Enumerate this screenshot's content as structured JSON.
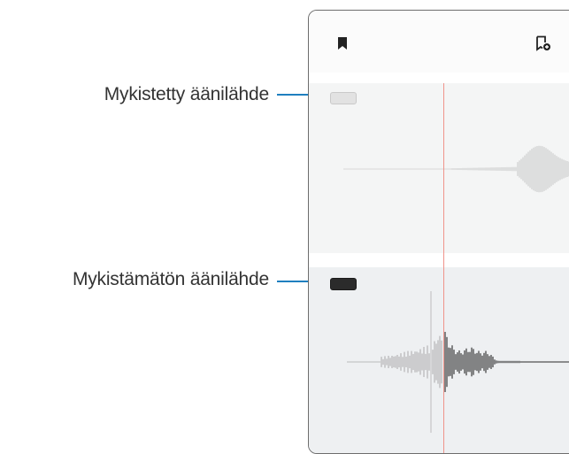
{
  "callouts": {
    "muted": "Mykistetty äänilähde",
    "unmuted": "Mykistämätön äänilähde"
  },
  "colors": {
    "callout_line": "#1f7fbf",
    "playhead": "#f0948b",
    "muted_wave": "#c6c6c6",
    "unmuted_wave": "#2a2a2a"
  },
  "icons": {
    "bookmark": "bookmark-icon",
    "add_bookmark": "add-bookmark-icon"
  }
}
